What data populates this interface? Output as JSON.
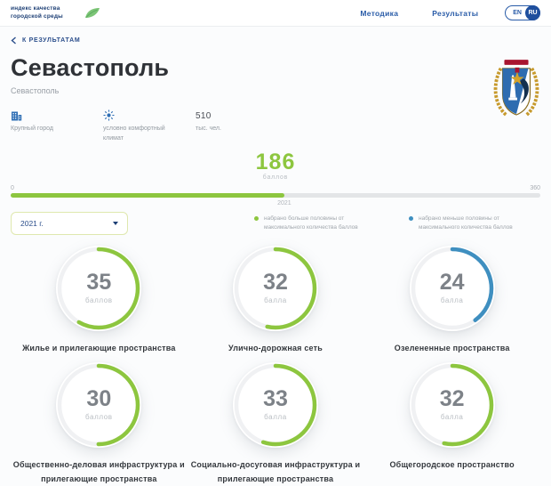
{
  "colors": {
    "green": "#8dc63f",
    "blue": "#3f8fc0",
    "navy": "#2a5ca8"
  },
  "header": {
    "logo_line1": "индекс качества",
    "logo_line2": "городской среды",
    "nav_methodology": "Методика",
    "nav_results": "Результаты",
    "lang_en": "EN",
    "lang_ru": "RU"
  },
  "breadcrumb": {
    "back_label": "К РЕЗУЛЬТАТАМ"
  },
  "city": {
    "title": "Севастополь",
    "subtitle": "Севастополь",
    "facts": [
      {
        "label": "Крупный город"
      },
      {
        "label": "условно комфортный климат"
      },
      {
        "value": "510",
        "label": "тыс. чел."
      }
    ]
  },
  "score": {
    "value": "186",
    "unit": "баллов",
    "min": "0",
    "max": "360",
    "year": "2021"
  },
  "filter": {
    "selected_year": "2021 г."
  },
  "legend": [
    {
      "color": "#8dc63f",
      "label": "набрано больше половины от максимального количества баллов"
    },
    {
      "color": "#3f8fc0",
      "label": "набрано меньше половины от максимального количества баллов"
    }
  ],
  "gauges": [
    {
      "value": 35,
      "max": 60,
      "unit": "баллов",
      "color": "green",
      "label": "Жилье и прилегающие пространства"
    },
    {
      "value": 32,
      "max": 60,
      "unit": "балла",
      "color": "green",
      "label": "Улично-дорожная сеть"
    },
    {
      "value": 24,
      "max": 60,
      "unit": "балла",
      "color": "blue",
      "label": "Озелененные пространства"
    },
    {
      "value": 30,
      "max": 60,
      "unit": "баллов",
      "color": "green",
      "label": "Общественно-деловая инфраструктура и прилегающие пространства"
    },
    {
      "value": 33,
      "max": 60,
      "unit": "балла",
      "color": "green",
      "label": "Социально-досуговая инфраструктура и прилегающие пространства"
    },
    {
      "value": 32,
      "max": 60,
      "unit": "балла",
      "color": "green",
      "label": "Общегородское пространство"
    }
  ],
  "chart_data": {
    "type": "gauge",
    "title": "186 баллов",
    "total": {
      "value": 186,
      "min": 0,
      "max": 360,
      "year": "2021"
    },
    "categories": [
      "Жилье и прилегающие пространства",
      "Улично-дорожная сеть",
      "Озелененные пространства",
      "Общественно-деловая инфраструктура и прилегающие пространства",
      "Социально-досуговая инфраструктура и прилегающие пространства",
      "Общегородское пространство"
    ],
    "values": [
      35,
      32,
      24,
      30,
      33,
      32
    ],
    "max_per_category": 60,
    "series_colors": [
      "#8dc63f",
      "#8dc63f",
      "#3f8fc0",
      "#8dc63f",
      "#8dc63f",
      "#8dc63f"
    ]
  }
}
